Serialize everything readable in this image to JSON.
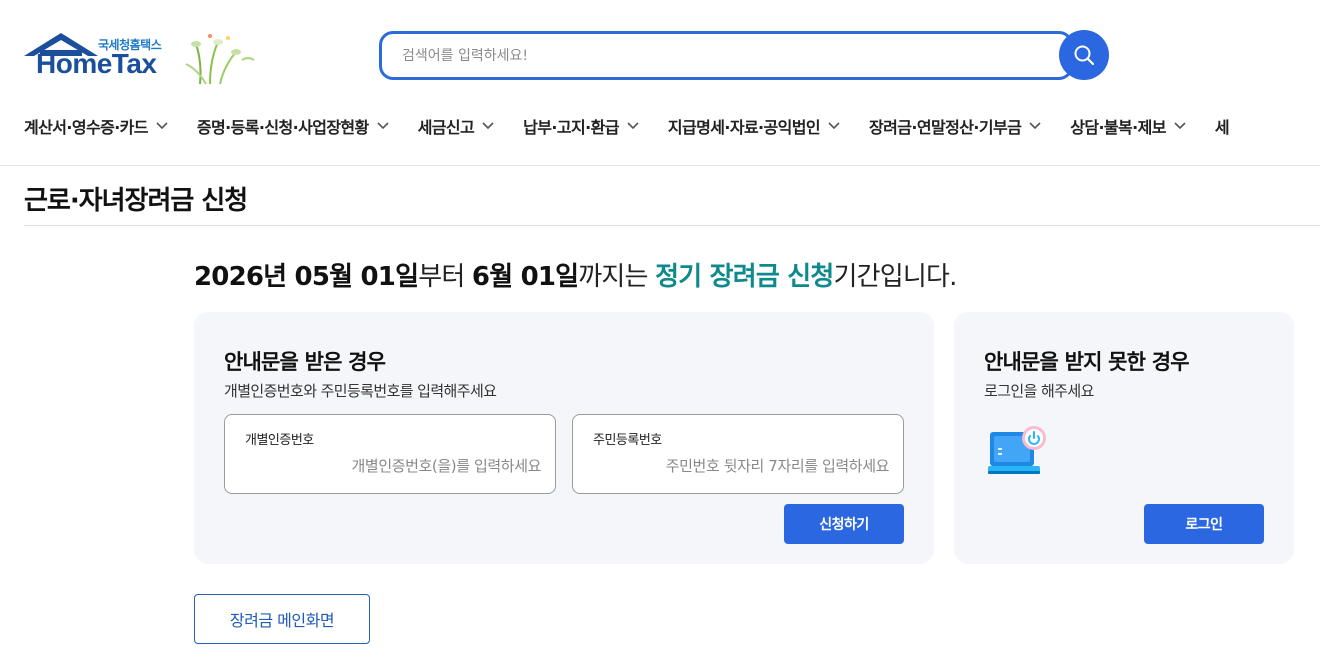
{
  "brand": {
    "sub_name": "국세청홈택스",
    "name": "HomeTax"
  },
  "search": {
    "placeholder": "검색어를 입력하세요!"
  },
  "nav": {
    "items": [
      {
        "label": "계산서·영수증·카드"
      },
      {
        "label": "증명·등록·신청·사업장현황"
      },
      {
        "label": "세금신고"
      },
      {
        "label": "납부·고지·환급"
      },
      {
        "label": "지급명세·자료·공익법인"
      },
      {
        "label": "장려금·연말정산·기부금"
      },
      {
        "label": "상담·불복·제보"
      },
      {
        "label": "세"
      }
    ]
  },
  "page": {
    "title": "근로·자녀장려금 신청"
  },
  "period": {
    "start_date": "2026년 05월 01일",
    "start_suffix": "부터 ",
    "end_date": "6월 01일",
    "end_suffix": "까지는 ",
    "highlight": "정기 장려금 신청",
    "tail": "기간입니다."
  },
  "notice_card": {
    "title": "안내문을 받은 경우",
    "description": "개별인증번호와 주민등록번호를 입력해주세요",
    "field_auth_label": "개별인증번호",
    "field_auth_placeholder": "개별인증번호(을)를 입력하세요",
    "field_rrn_label": "주민등록번호",
    "field_rrn_placeholder": "주민번호 뒷자리 7자리를 입력하세요",
    "apply_button": "신청하기"
  },
  "no_notice_card": {
    "title": "안내문을 받지 못한 경우",
    "description": "로그인을 해주세요",
    "login_button": "로그인"
  },
  "main_button": "장려금 메인화면",
  "colors": {
    "primary": "#2a67e0",
    "accent_teal": "#0f8a8c",
    "card_bg": "#f4f6fa"
  }
}
